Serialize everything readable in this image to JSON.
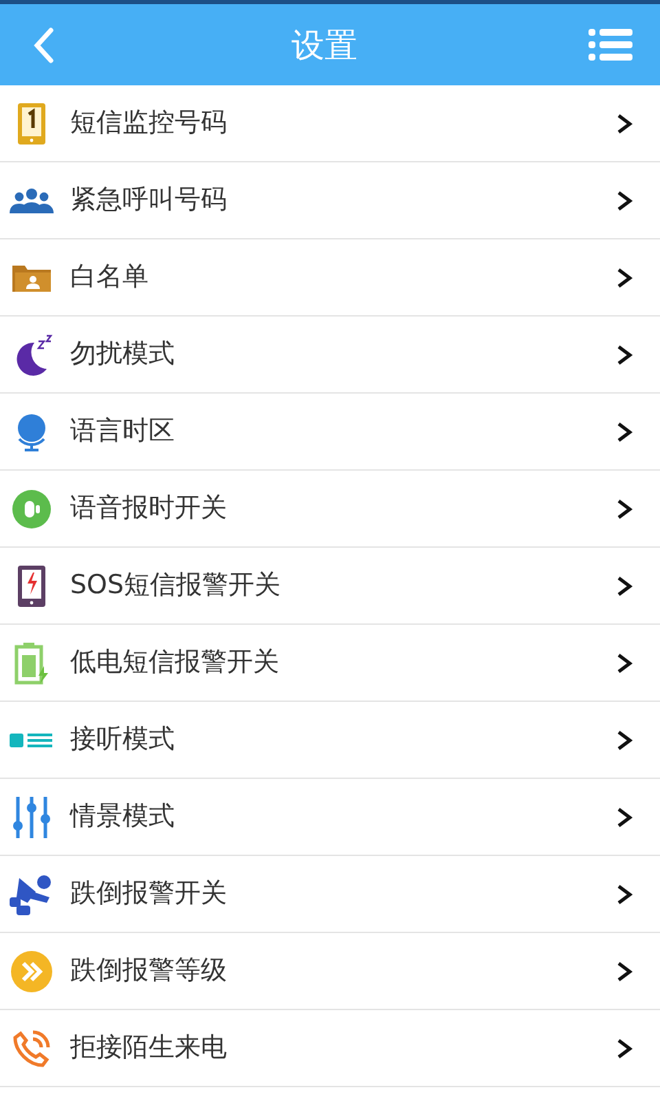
{
  "header": {
    "title": "设置"
  },
  "items": [
    {
      "label": "短信监控号码"
    },
    {
      "label": "紧急呼叫号码"
    },
    {
      "label": "白名单"
    },
    {
      "label": "勿扰模式"
    },
    {
      "label": "语言时区"
    },
    {
      "label": "语音报时开关"
    },
    {
      "label": "SOS短信报警开关"
    },
    {
      "label": "低电短信报警开关"
    },
    {
      "label": "接听模式"
    },
    {
      "label": "情景模式"
    },
    {
      "label": "跌倒报警开关"
    },
    {
      "label": "跌倒报警等级"
    },
    {
      "label": "拒接陌生来电"
    }
  ]
}
